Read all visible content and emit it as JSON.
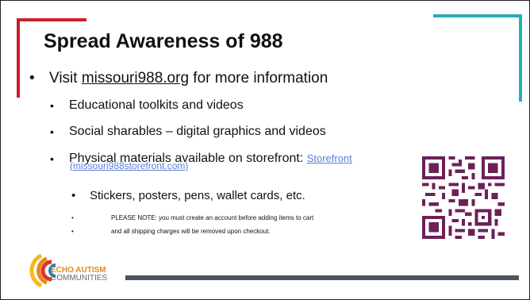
{
  "slide": {
    "title": "Spread Awareness of 988",
    "bullet_main": {
      "prefix": "Visit ",
      "link": "missouri988.org",
      "suffix": " for more information"
    },
    "sub_bullets": [
      "Educational toolkits and videos",
      "Social sharables – digital graphics and videos"
    ],
    "storefront": {
      "text": "Physical materials available on storefront: ",
      "link": "Storefront",
      "link_sub": "(missouri988storefront.com)"
    },
    "sub_sub_bullet": "Stickers, posters, pens, wallet cards, etc.",
    "notes": [
      "PLEASE NOTE: you must create an account before adding items to cart",
      "and all shipping charges will be removed upon checkout."
    ],
    "bullet_glyph": "•"
  },
  "logo": {
    "line1": "ECHO AUTISM",
    "line2": "COMMUNITIES",
    "colors": [
      "#f5b81c",
      "#e48a1b",
      "#d9352b",
      "#1f86b8"
    ]
  },
  "colors": {
    "accent_red": "#c8202f",
    "accent_teal": "#2aaeb5",
    "qr": "#6b2158",
    "link": "#5b7fd6",
    "footer_bar": "#4a5560"
  }
}
